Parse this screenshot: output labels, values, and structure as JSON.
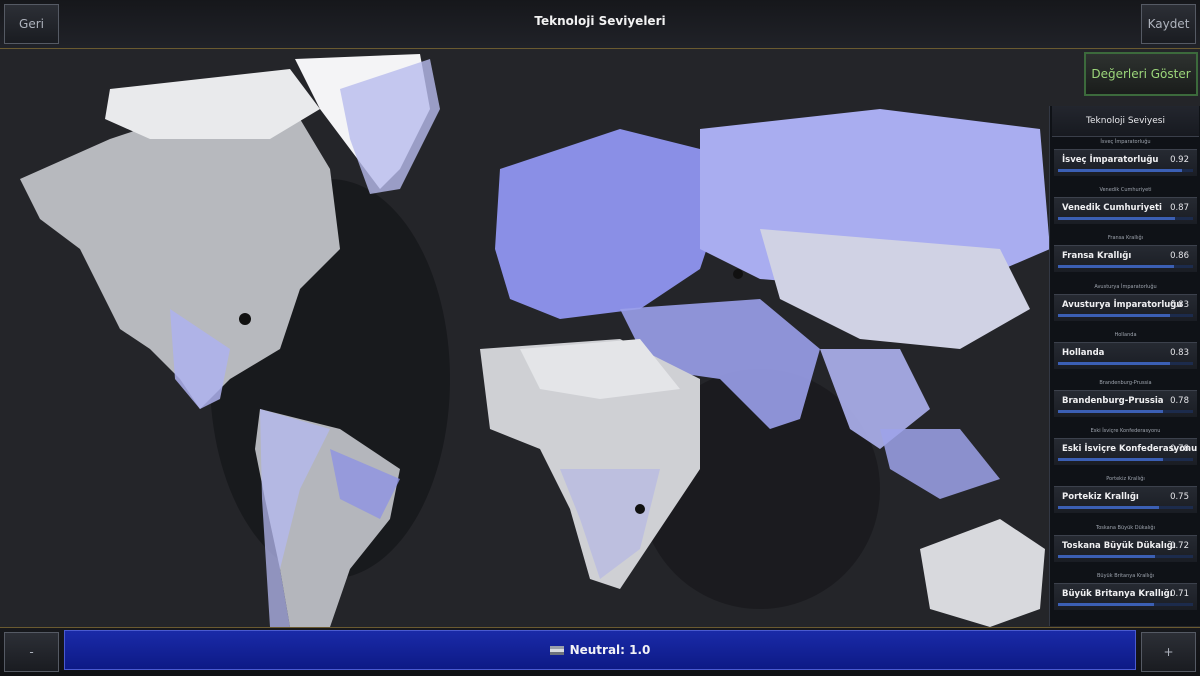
{
  "header": {
    "title": "Teknoloji Seviyeleri",
    "back_label": "Geri",
    "save_label": "Kaydet"
  },
  "toggle": {
    "show_values_label": "Değerleri Göster"
  },
  "panel": {
    "heading": "Teknoloji Seviyesi",
    "entries": [
      {
        "small": "İsveç İmparatorluğu",
        "name": "İsveç İmparatorluğu",
        "value": "0.92",
        "fill": 0.92
      },
      {
        "small": "Venedik Cumhuriyeti",
        "name": "Venedik Cumhuriyeti",
        "value": "0.87",
        "fill": 0.87
      },
      {
        "small": "Fransa Krallığı",
        "name": "Fransa Krallığı",
        "value": "0.86",
        "fill": 0.86
      },
      {
        "small": "Avusturya İmparatorluğu",
        "name": "Avusturya İmparatorluğu",
        "value": "0.83",
        "fill": 0.83
      },
      {
        "small": "Hollanda",
        "name": "Hollanda",
        "value": "0.83",
        "fill": 0.83
      },
      {
        "small": "Brandenburg-Prussia",
        "name": "Brandenburg-Prussia",
        "value": "0.78",
        "fill": 0.78
      },
      {
        "small": "Eski İsviçre Konfederasyonu",
        "name": "Eski İsviçre Konfederasyonu",
        "value": "0.78",
        "fill": 0.78
      },
      {
        "small": "Portekiz Krallığı",
        "name": "Portekiz Krallığı",
        "value": "0.75",
        "fill": 0.75
      },
      {
        "small": "Toskana Büyük Dükalığı",
        "name": "Toskana Büyük Dükalığı",
        "value": "0.72",
        "fill": 0.72
      },
      {
        "small": "Büyük Britanya Krallığı",
        "name": "Büyük Britanya Krallığı",
        "value": "0.71",
        "fill": 0.71
      }
    ]
  },
  "footer": {
    "minus_label": "-",
    "plus_label": "+",
    "neutral_label": "Neutral: 1.0"
  },
  "colors": {
    "tech_tint": "#8a8fe6",
    "accent_gold": "#6a5a30",
    "neutral_bar": "#0d1a86",
    "toggle_text": "#9cd67a"
  },
  "icons": {
    "neutral_flag": "flag-icon"
  }
}
